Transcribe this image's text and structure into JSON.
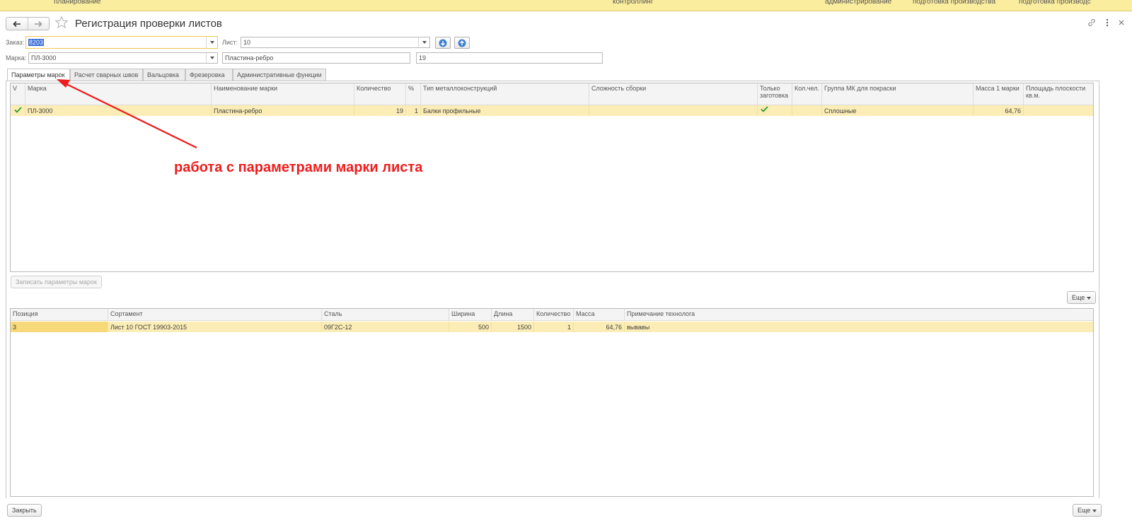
{
  "sections": {
    "item1": "планирование",
    "item2": "контроллинг",
    "item3": "администрирование",
    "item4": "подготовка производства",
    "item5": "подготовка производс"
  },
  "header": {
    "title": "Регистрация проверки листов"
  },
  "form": {
    "order_label": "Заказ:",
    "order_value": "8203",
    "sheet_label": "Лист:",
    "sheet_value": "10",
    "mark_label": "Марка:",
    "mark_value": "ПЛ-3000",
    "mark_name_value": "Пластина-ребро",
    "mark_qty_value": "19"
  },
  "tabs": [
    "Параметры марок",
    "Расчет сварных швов",
    "Вальцовка",
    "Фрезеровка",
    "Административные функции"
  ],
  "marks_table": {
    "columns": [
      "V",
      "Марка",
      "Наименование марки",
      "Количество",
      "%",
      "Тип металлоконструкций",
      "Сложность сборки",
      "Только заготовка",
      "Кол.чел.",
      "Группа МК для покраски",
      "Масса 1 марки",
      "Площадь плоскости кв.м."
    ],
    "row": {
      "mark": "ПЛ-3000",
      "name": "Пластина-ребро",
      "qty": "19",
      "percent": "1",
      "type": "Балки профильные",
      "complexity": "",
      "workers": "",
      "paint_group": "Сплошные",
      "mass": "64,76",
      "area": ""
    }
  },
  "save_params_label": "Записать параметры марок",
  "more_label": "Еще",
  "positions_table": {
    "columns": [
      "Позиция",
      "Сортамент",
      "Сталь",
      "Ширина",
      "Длина",
      "Количество",
      "Масса",
      "Примечание технолога"
    ],
    "row": {
      "position": "3",
      "assortment": "Лист 10 ГОСТ 19903-2015",
      "steel": "09Г2С-12",
      "width": "500",
      "length": "1500",
      "qty": "1",
      "mass": "64,76",
      "note": "вывавы"
    }
  },
  "close_label": "Закрыть",
  "annotation": "работа с параметрами марки листа",
  "colors": {
    "accent": "#f2c54e",
    "row_selected": "#fbedb5",
    "section_bar": "#fbed9e",
    "annotation": "#ee1c1c",
    "check": "#2e9a2e",
    "arrow_button": "#3d80cf"
  }
}
